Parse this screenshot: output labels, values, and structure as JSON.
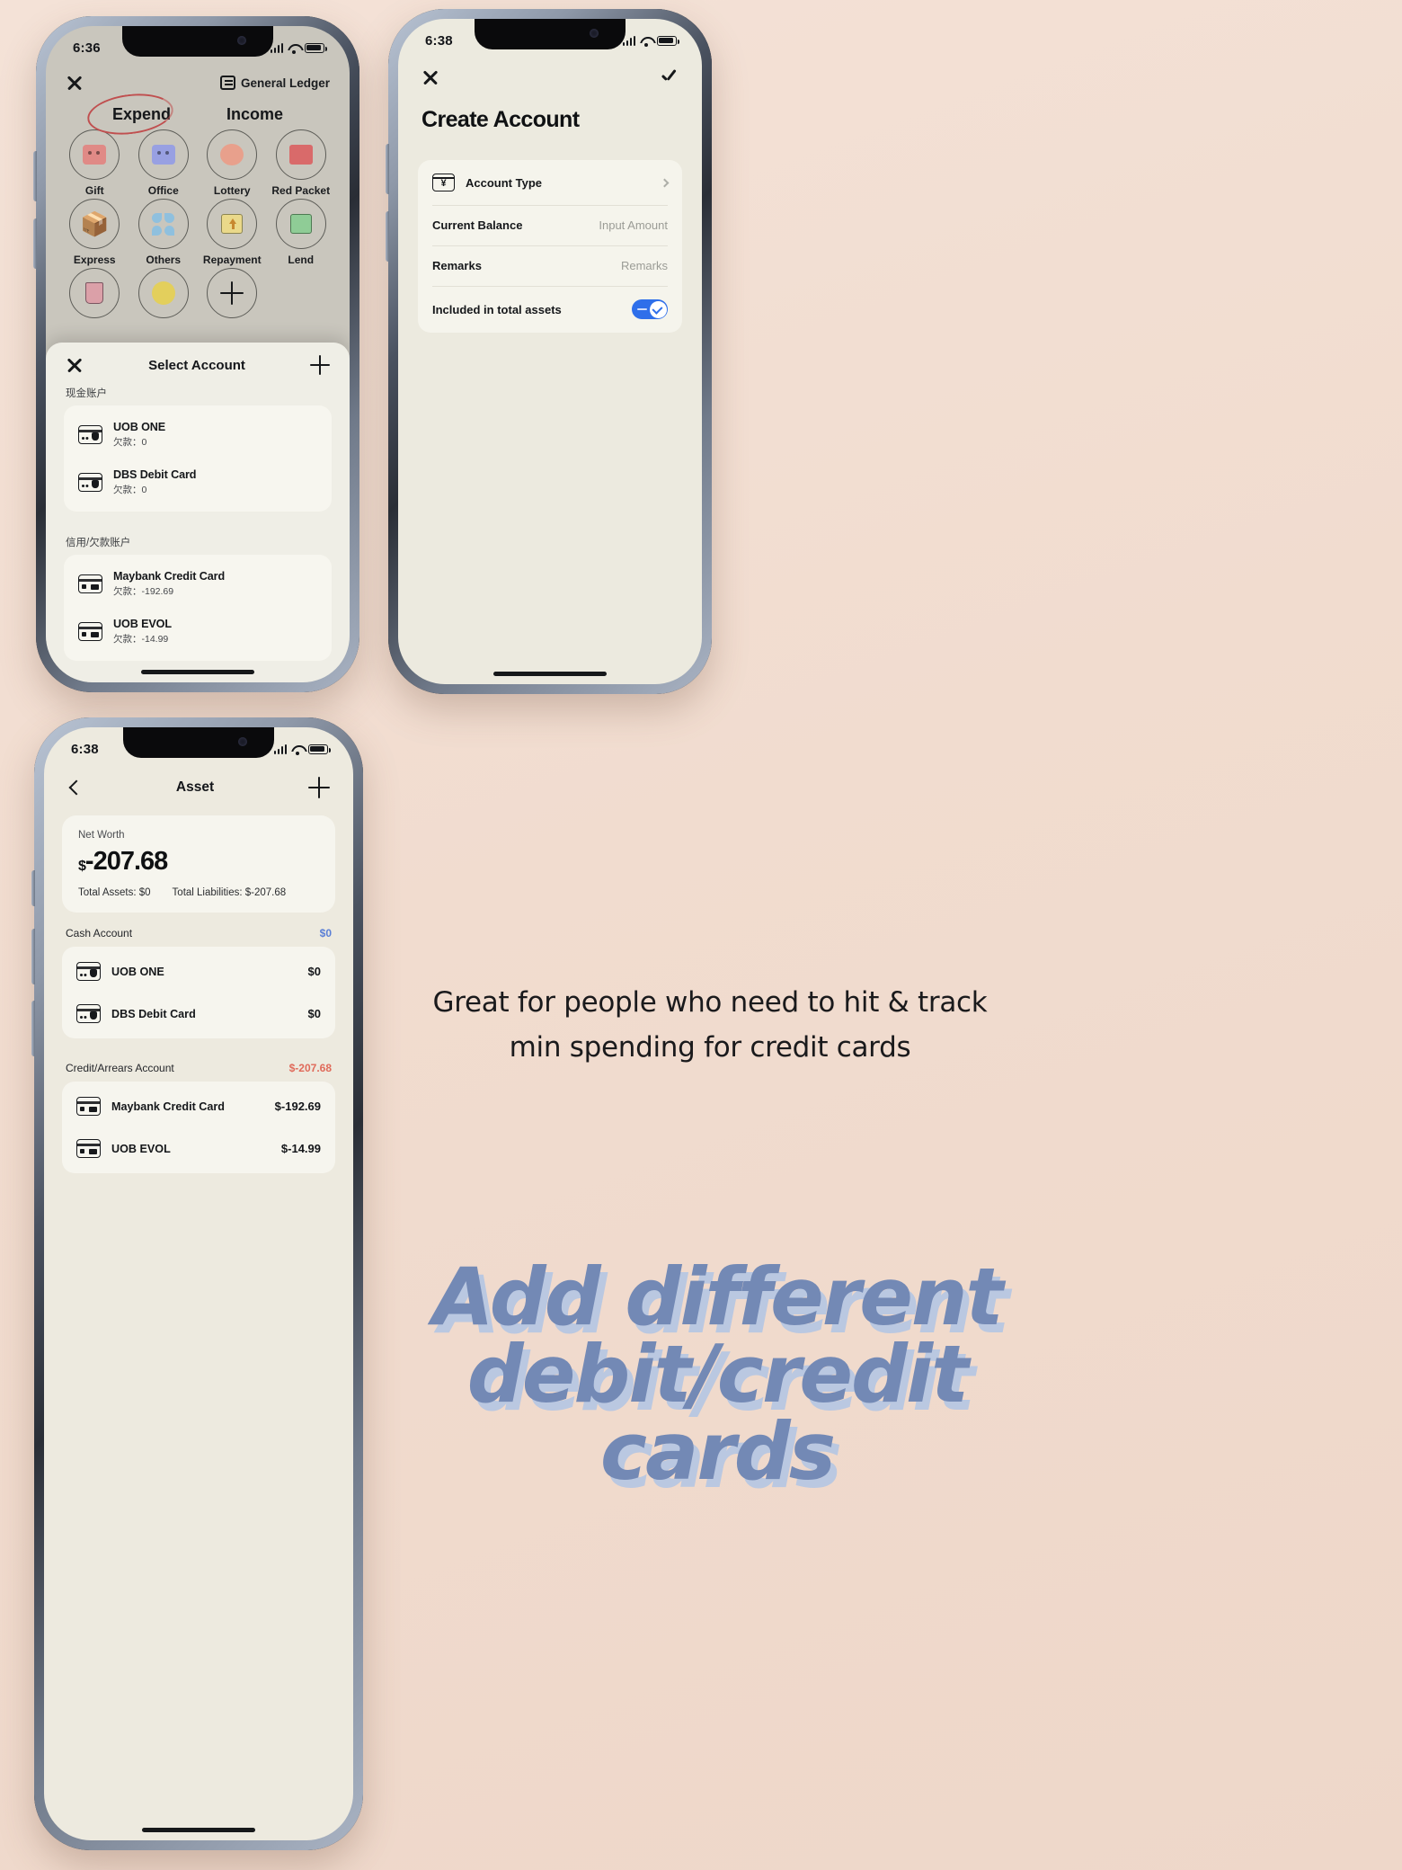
{
  "phone1": {
    "status": {
      "time": "6:36"
    },
    "nav": {
      "close_icon": "close-icon",
      "ledger_label": "General Ledger",
      "ledger_icon": "ledger-icon"
    },
    "tabs": [
      {
        "label": "Expend",
        "selected": true,
        "annotation": "red-ellipse-circle"
      },
      {
        "label": "Income",
        "selected": false
      }
    ],
    "categories": [
      {
        "label": "Gift",
        "icon": "gift-bag-icon"
      },
      {
        "label": "Office",
        "icon": "office-bag-icon"
      },
      {
        "label": "Lottery",
        "icon": "lottery-icon"
      },
      {
        "label": "Red Packet",
        "icon": "red-packet-icon"
      },
      {
        "label": "Express",
        "icon": "parcel-box-icon"
      },
      {
        "label": "Others",
        "icon": "four-circles-icon"
      },
      {
        "label": "Repayment",
        "icon": "repayment-upload-icon"
      },
      {
        "label": "Lend",
        "icon": "lend-arrow-icon"
      },
      {
        "label": "",
        "icon": "coffee-cup-icon"
      },
      {
        "label": "",
        "icon": "star-eyes-face-icon"
      },
      {
        "label": "",
        "icon": "plus-icon"
      }
    ],
    "sheet": {
      "close_icon": "close-icon",
      "title": "Select Account",
      "add_icon": "plus-icon",
      "groups": [
        {
          "label": "现金账户",
          "rows": [
            {
              "name": "UOB ONE",
              "sub": "欠款：0",
              "icon": "debit-card-icon"
            },
            {
              "name": "DBS Debit Card",
              "sub": "欠款：0",
              "icon": "debit-card-icon"
            }
          ]
        },
        {
          "label": "信用/欠款账户",
          "rows": [
            {
              "name": "Maybank Credit Card",
              "sub": "欠款：-192.69",
              "icon": "credit-card-icon"
            },
            {
              "name": "UOB EVOL",
              "sub": "欠款：-14.99",
              "icon": "credit-card-icon"
            }
          ]
        }
      ]
    }
  },
  "phone2": {
    "status": {
      "time": "6:38"
    },
    "nav": {
      "close_icon": "close-icon",
      "confirm_icon": "checkmark-icon"
    },
    "title": "Create Account",
    "form": [
      {
        "label": "Account Type",
        "value": "",
        "icon": "yen-card-icon",
        "accessory": "chevron-right-icon"
      },
      {
        "label": "Current Balance",
        "value": "Input Amount",
        "placeholder": "Input Amount"
      },
      {
        "label": "Remarks",
        "value": "Remarks",
        "placeholder": "Remarks"
      },
      {
        "label": "Included in total assets",
        "toggle": true,
        "toggle_on": true
      }
    ],
    "colors": {
      "toggle_on": "#2f6fea"
    }
  },
  "phone3": {
    "status": {
      "time": "6:38"
    },
    "nav": {
      "back_icon": "chevron-left-icon",
      "title": "Asset",
      "add_icon": "plus-icon"
    },
    "net_worth": {
      "label": "Net Worth",
      "currency": "$",
      "amount": "-207.68",
      "total_assets": "Total Assets: $0",
      "total_liabilities": "Total Liabilities: $-207.68"
    },
    "sections": [
      {
        "title": "Cash Account",
        "total": "$0",
        "total_color": "#5a7fd6",
        "rows": [
          {
            "name": "UOB ONE",
            "amount": "$0",
            "icon": "debit-card-icon"
          },
          {
            "name": "DBS Debit Card",
            "amount": "$0",
            "icon": "debit-card-icon"
          }
        ]
      },
      {
        "title": "Credit/Arrears Account",
        "total": "$-207.68",
        "total_color": "#e06a5a",
        "rows": [
          {
            "name": "Maybank Credit Card",
            "amount": "$-192.69",
            "icon": "credit-card-icon"
          },
          {
            "name": "UOB EVOL",
            "amount": "$-14.99",
            "icon": "credit-card-icon"
          }
        ]
      }
    ]
  },
  "annotations": {
    "caption_line1": "Great for people who need to hit & track",
    "caption_line2": "min spending for credit cards",
    "headline": "Add different debit/credit cards",
    "headline_color": "#7389b5"
  }
}
